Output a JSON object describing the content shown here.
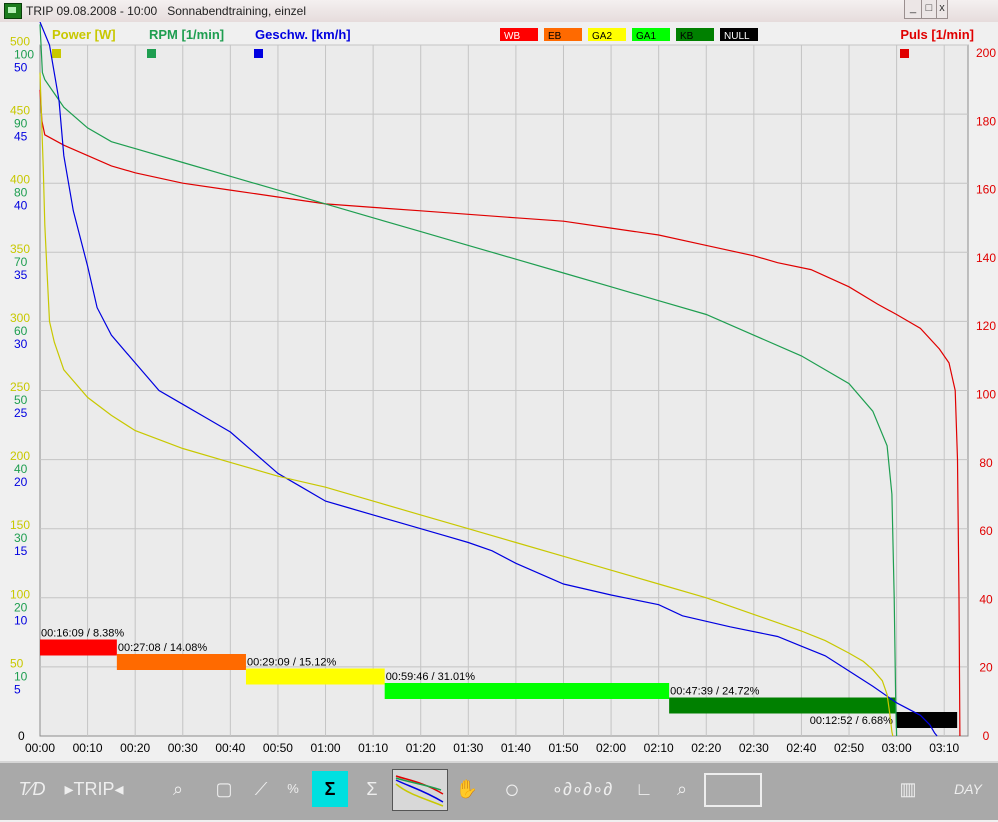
{
  "window": {
    "title": "TRIP 09.08.2008 - 10:00   Sonnabendtraining, einzel",
    "minimize_label": "_",
    "maximize_label": "□",
    "close_label": "x"
  },
  "header": {
    "power": {
      "label": "Power [W]",
      "color": "#c8c800"
    },
    "rpm": {
      "label": "RPM [1/min]",
      "color": "#1e9e50"
    },
    "speed": {
      "label": "Geschw. [km/h]",
      "color": "#0000e0"
    },
    "pulse": {
      "label": "Puls [1/min]",
      "color": "#e00000"
    },
    "zones": [
      {
        "label": "WB",
        "color": "#ff0000",
        "text_color": "#ffffff"
      },
      {
        "label": "EB",
        "color": "#ff6a00",
        "text_color": "#000000"
      },
      {
        "label": "GA2",
        "color": "#ffff00",
        "text_color": "#000000"
      },
      {
        "label": "GA1",
        "color": "#00ff00",
        "text_color": "#000000"
      },
      {
        "label": "KB",
        "color": "#008000",
        "text_color": "#000000"
      },
      {
        "label": "NULL",
        "color": "#000000",
        "text_color": "#ffffff"
      }
    ]
  },
  "chart_data": {
    "type": "line",
    "description_note": "",
    "x_ticks": [
      "00:00",
      "00:10",
      "00:20",
      "00:30",
      "00:40",
      "00:50",
      "01:00",
      "01:10",
      "01:20",
      "01:30",
      "01:40",
      "01:50",
      "02:00",
      "02:10",
      "02:20",
      "02:30",
      "02:40",
      "02:50",
      "03:00",
      "03:10"
    ],
    "x_range_minutes": [
      0,
      195
    ],
    "left_axes": {
      "power_ticks": [
        "500",
        "450",
        "400",
        "350",
        "300",
        "250",
        "200",
        "150",
        "100",
        "50"
      ],
      "rpm_ticks": [
        "100",
        "90",
        "80",
        "70",
        "60",
        "50",
        "40",
        "30",
        "20",
        "10"
      ],
      "speed_ticks": [
        "50",
        "45",
        "40",
        "35",
        "30",
        "25",
        "20",
        "15",
        "10",
        "5"
      ],
      "zero_label": "0",
      "power_range": [
        0,
        500
      ],
      "rpm_range": [
        0,
        100
      ],
      "speed_range": [
        0,
        50
      ]
    },
    "right_axis": {
      "ticks": [
        "200",
        "180",
        "160",
        "140",
        "120",
        "100",
        "80",
        "60",
        "40",
        "20",
        "0"
      ],
      "range": [
        0,
        200
      ]
    },
    "grid": true,
    "series": [
      {
        "name": "Puls [1/min]",
        "axis": "pulse",
        "color": "#e00000",
        "points": [
          [
            0,
            187
          ],
          [
            0.4,
            178
          ],
          [
            1,
            174
          ],
          [
            5,
            171
          ],
          [
            10,
            168
          ],
          [
            15,
            165
          ],
          [
            20,
            163
          ],
          [
            30,
            160
          ],
          [
            40,
            158
          ],
          [
            50,
            156
          ],
          [
            60,
            154
          ],
          [
            70,
            153
          ],
          [
            80,
            152
          ],
          [
            90,
            151
          ],
          [
            100,
            150
          ],
          [
            110,
            149
          ],
          [
            120,
            147
          ],
          [
            130,
            145
          ],
          [
            140,
            142
          ],
          [
            150,
            139
          ],
          [
            155,
            137
          ],
          [
            162,
            135
          ],
          [
            170,
            130
          ],
          [
            176,
            125
          ],
          [
            180,
            122
          ],
          [
            185,
            118
          ],
          [
            189,
            112
          ],
          [
            191,
            108
          ],
          [
            192.3,
            100
          ],
          [
            192.8,
            80
          ],
          [
            193.1,
            40
          ],
          [
            193.3,
            0
          ]
        ]
      },
      {
        "name": "RPM [1/min]",
        "axis": "rpm",
        "color": "#1e9e50",
        "points": [
          [
            0,
            103
          ],
          [
            0.5,
            96
          ],
          [
            1,
            95
          ],
          [
            3,
            93
          ],
          [
            5,
            91
          ],
          [
            10,
            88
          ],
          [
            15,
            86
          ],
          [
            20,
            85
          ],
          [
            30,
            83
          ],
          [
            40,
            81
          ],
          [
            50,
            79
          ],
          [
            60,
            77
          ],
          [
            70,
            75
          ],
          [
            80,
            73
          ],
          [
            90,
            71
          ],
          [
            100,
            69
          ],
          [
            110,
            67
          ],
          [
            120,
            65
          ],
          [
            130,
            63
          ],
          [
            140,
            61
          ],
          [
            150,
            58
          ],
          [
            160,
            55
          ],
          [
            170,
            51
          ],
          [
            175,
            47
          ],
          [
            178,
            42
          ],
          [
            179,
            35
          ],
          [
            179.5,
            20
          ],
          [
            179.8,
            5
          ],
          [
            180,
            0
          ]
        ]
      },
      {
        "name": "Geschw. [km/h]",
        "axis": "speed",
        "color": "#0000e0",
        "points": [
          [
            0,
            53
          ],
          [
            2,
            50
          ],
          [
            4,
            46
          ],
          [
            5,
            42
          ],
          [
            7,
            38
          ],
          [
            10,
            34
          ],
          [
            12,
            31
          ],
          [
            15,
            29
          ],
          [
            20,
            27
          ],
          [
            25,
            25
          ],
          [
            30,
            24
          ],
          [
            35,
            23
          ],
          [
            40,
            22
          ],
          [
            45,
            20.5
          ],
          [
            50,
            19
          ],
          [
            55,
            18
          ],
          [
            60,
            17
          ],
          [
            65,
            16.5
          ],
          [
            70,
            16
          ],
          [
            75,
            15.5
          ],
          [
            80,
            15
          ],
          [
            85,
            14.5
          ],
          [
            90,
            14
          ],
          [
            95,
            13.4
          ],
          [
            100,
            12.5
          ],
          [
            110,
            11
          ],
          [
            120,
            10.2
          ],
          [
            130,
            9.5
          ],
          [
            135,
            8.7
          ],
          [
            145,
            7.9
          ],
          [
            155,
            7.2
          ],
          [
            160,
            6.5
          ],
          [
            165,
            5.8
          ],
          [
            170,
            4.7
          ],
          [
            175,
            3.6
          ],
          [
            180,
            2.4
          ],
          [
            185,
            1.5
          ],
          [
            187,
            0.8
          ],
          [
            188,
            0.2
          ],
          [
            188.5,
            0
          ]
        ]
      },
      {
        "name": "Power [W]",
        "axis": "power",
        "color": "#c8c800",
        "points": [
          [
            0,
            480
          ],
          [
            0.3,
            450
          ],
          [
            0.7,
            410
          ],
          [
            1,
            370
          ],
          [
            1.5,
            335
          ],
          [
            2,
            300
          ],
          [
            3,
            285
          ],
          [
            5,
            265
          ],
          [
            10,
            245
          ],
          [
            15,
            232
          ],
          [
            20,
            221
          ],
          [
            30,
            208
          ],
          [
            40,
            198
          ],
          [
            50,
            188
          ],
          [
            60,
            180
          ],
          [
            70,
            170
          ],
          [
            80,
            160
          ],
          [
            90,
            150
          ],
          [
            100,
            140
          ],
          [
            110,
            130
          ],
          [
            120,
            120
          ],
          [
            130,
            110
          ],
          [
            140,
            100
          ],
          [
            150,
            88
          ],
          [
            160,
            76
          ],
          [
            165,
            69
          ],
          [
            170,
            60
          ],
          [
            173,
            54
          ],
          [
            175,
            48
          ],
          [
            177,
            40
          ],
          [
            178,
            30
          ],
          [
            178.6,
            15
          ],
          [
            179,
            3
          ],
          [
            179.2,
            0
          ]
        ]
      }
    ],
    "zone_bars": [
      {
        "zone": "WB",
        "label": "00:16:09 /  8.38%",
        "start_min": 0,
        "duration_min": 16.15,
        "color": "#ff0000"
      },
      {
        "zone": "EB",
        "label": "00:27:08 / 14.08%",
        "start_min": 16.15,
        "duration_min": 27.13,
        "color": "#ff6a00"
      },
      {
        "zone": "GA2",
        "label": "00:29:09 / 15.12%",
        "start_min": 43.28,
        "duration_min": 29.15,
        "color": "#ffff00"
      },
      {
        "zone": "GA1",
        "label": "00:59:46 / 31.01%",
        "start_min": 72.43,
        "duration_min": 59.77,
        "color": "#00ff00"
      },
      {
        "zone": "KB",
        "label": "00:47:39 / 24.72%",
        "start_min": 132.2,
        "duration_min": 47.65,
        "color": "#008000"
      },
      {
        "zone": "NULL",
        "label": "00:12:52 /  6.68%",
        "start_min": 179.85,
        "duration_min": 12.87,
        "color": "#000000"
      }
    ]
  },
  "toolbar": {
    "trip_label": "TRIP",
    "buttons": [
      "td-icon",
      "trip-button",
      "zoom-in-icon",
      "zoom-out-icon",
      "cut-icon",
      "time-3d-icon",
      "sum-trip-icon",
      "sum-ip-icon",
      "chart-thumbnail-icon",
      "hand-icon",
      "circle-icon",
      "speed-tools-icon",
      "bracket-icon",
      "zoom-region-icon",
      "blank-button",
      "columns-icon",
      "day-icon"
    ]
  }
}
